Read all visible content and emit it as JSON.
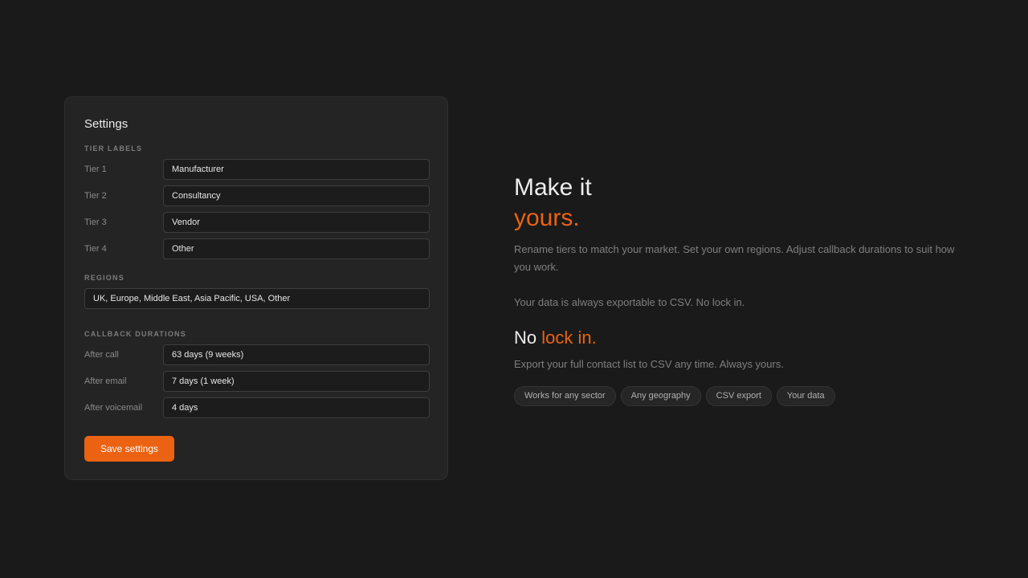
{
  "settings": {
    "title": "Settings",
    "tier_labels_heading": "TIER LABELS",
    "tiers": [
      {
        "label": "Tier 1",
        "value": "Manufacturer"
      },
      {
        "label": "Tier 2",
        "value": "Consultancy"
      },
      {
        "label": "Tier 3",
        "value": "Vendor"
      },
      {
        "label": "Tier 4",
        "value": "Other"
      }
    ],
    "regions_heading": "REGIONS",
    "regions_value": "UK, Europe, Middle East, Asia Pacific, USA, Other",
    "callback_heading": "CALLBACK DURATIONS",
    "callbacks": [
      {
        "label": "After call",
        "value": "63 days (9 weeks)"
      },
      {
        "label": "After email",
        "value": "7 days (1 week)"
      },
      {
        "label": "After voicemail",
        "value": "4 days"
      }
    ],
    "save_label": "Save settings"
  },
  "hero": {
    "line1": "Make it",
    "line2": "yours.",
    "para1": "Rename tiers to match your market. Set your own regions. Adjust callback durations to suit how you work.",
    "para2": "Your data is always exportable to CSV. No lock in.",
    "sub_heading_plain": "No",
    "sub_heading_accent": "lock in.",
    "para3": "Export your full contact list to CSV any time. Always yours.",
    "chips": [
      "Works for any sector",
      "Any geography",
      "CSV export",
      "Your data"
    ]
  },
  "colors": {
    "background": "#1a1a1a",
    "card": "#242424",
    "accent": "#ea6212"
  }
}
